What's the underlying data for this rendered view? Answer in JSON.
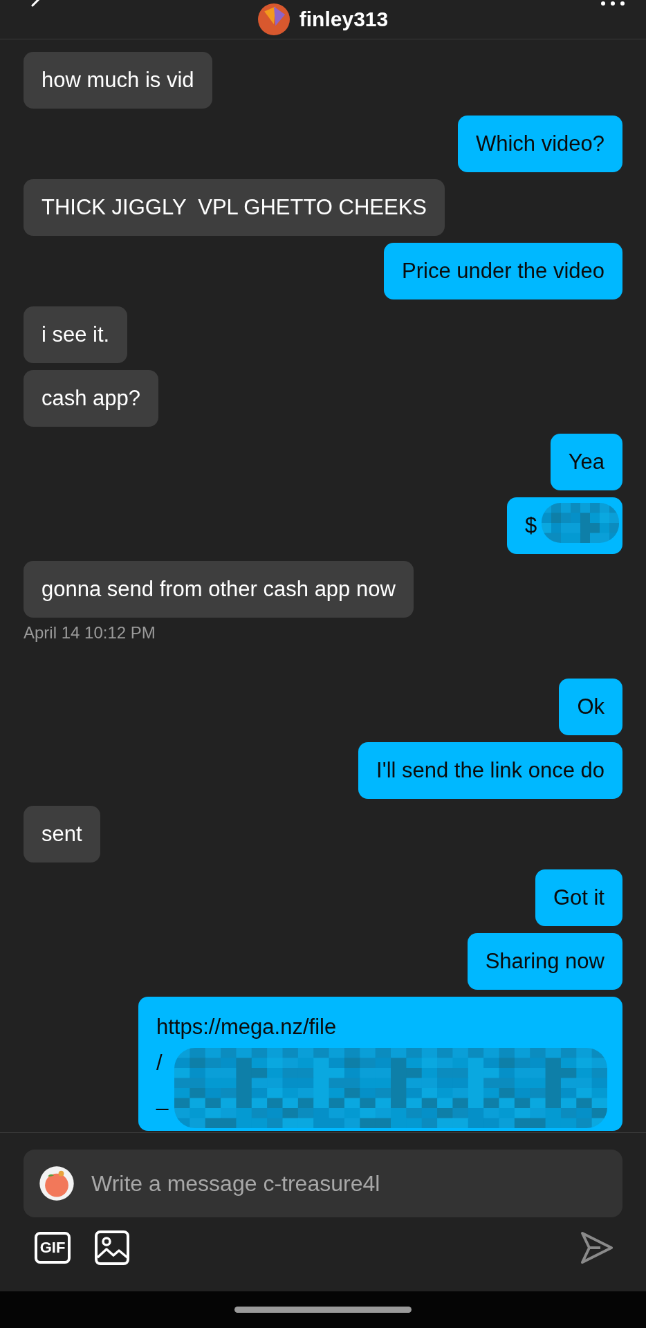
{
  "header": {
    "title": "finley313"
  },
  "messages": [
    {
      "kind": "in",
      "text": "how much is vid"
    },
    {
      "kind": "out",
      "text": "Which video?"
    },
    {
      "kind": "in",
      "text": "THICK JIGGLY  VPL GHETTO CHEEKS"
    },
    {
      "kind": "out",
      "text": "Price under the video"
    },
    {
      "kind": "in",
      "text": "i see it."
    },
    {
      "kind": "in",
      "text": "cash app?"
    },
    {
      "kind": "out",
      "text": "Yea"
    },
    {
      "kind": "out",
      "text": "$",
      "redacted": true
    },
    {
      "kind": "in",
      "text": "gonna send from other cash app now"
    },
    {
      "kind": "time",
      "text": "April 14 10:12 PM"
    },
    {
      "kind": "out",
      "text": "Ok"
    },
    {
      "kind": "out",
      "text": "I'll send the link once do"
    },
    {
      "kind": "in",
      "text": "sent"
    },
    {
      "kind": "out",
      "text": "Got it"
    },
    {
      "kind": "out",
      "text": "Sharing now"
    },
    {
      "kind": "link",
      "lines": [
        "https://mega.nz/file",
        "/",
        "_"
      ],
      "redacted": true
    }
  ],
  "composer": {
    "placeholder": "Write a message c-treasure4l",
    "gif_label": "GIF"
  }
}
